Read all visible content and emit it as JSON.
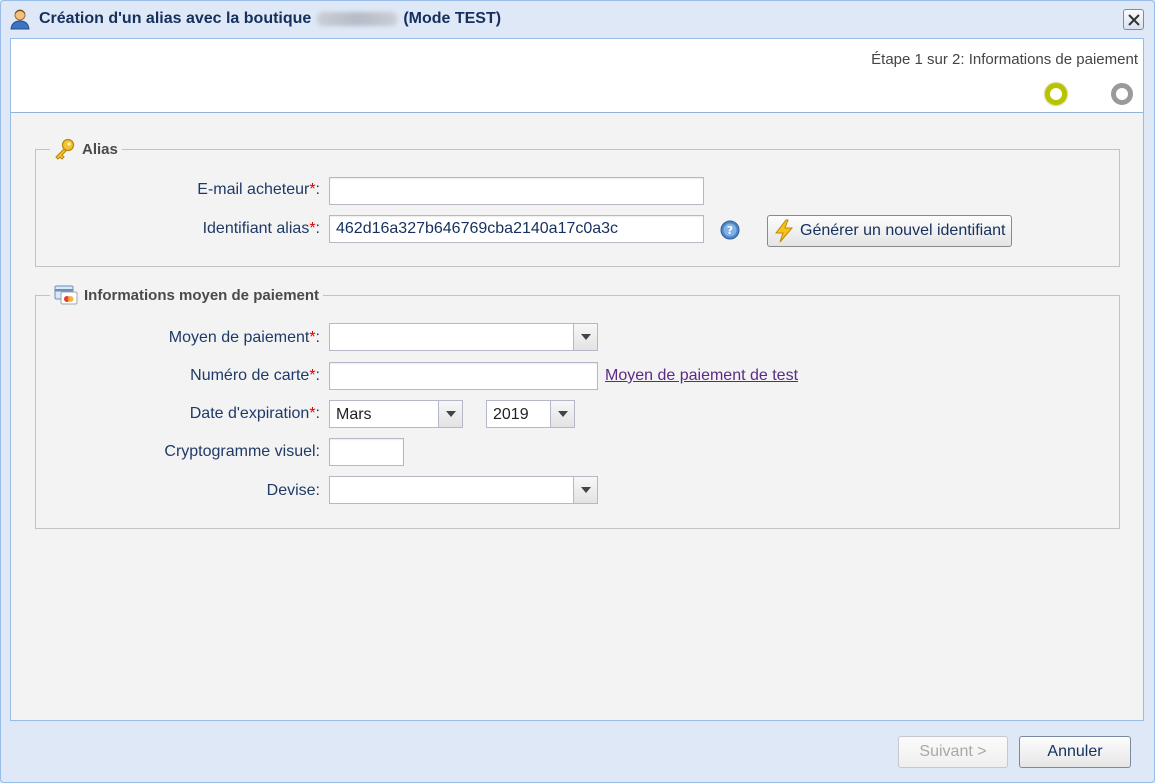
{
  "window": {
    "title_prefix": "Création d'un alias avec la boutique",
    "title_suffix": "(Mode TEST)",
    "icons": {
      "title": "user-icon",
      "close": "close-icon"
    }
  },
  "steps": {
    "text": "Étape 1 sur 2: Informations de paiement",
    "current": 1,
    "total": 2,
    "active_color": "#b9c400",
    "inactive_color": "#9a9a9a"
  },
  "alias_section": {
    "legend": "Alias",
    "icon": "key-icon",
    "email": {
      "label": "E-mail acheteur",
      "value": ""
    },
    "identifier": {
      "label": "Identifiant alias",
      "value": "462d16a327b646769cba2140a17c0a3c"
    },
    "generate_button": "Générer un nouvel identifiant",
    "required_marker": "*",
    "separator": ":"
  },
  "payment_section": {
    "legend": "Informations moyen de paiement",
    "icon": "card-icon",
    "payment_method": {
      "label": "Moyen de paiement",
      "value": ""
    },
    "card_number": {
      "label": "Numéro de carte",
      "value": ""
    },
    "test_link": "Moyen de paiement de test",
    "expiration": {
      "label": "Date d'expiration",
      "month": "Mars",
      "year": "2019"
    },
    "cvv": {
      "label": "Cryptogramme visuel",
      "value": ""
    },
    "currency": {
      "label": "Devise",
      "value": ""
    }
  },
  "footer": {
    "next_button": "Suivant >",
    "cancel_button": "Annuler"
  }
}
